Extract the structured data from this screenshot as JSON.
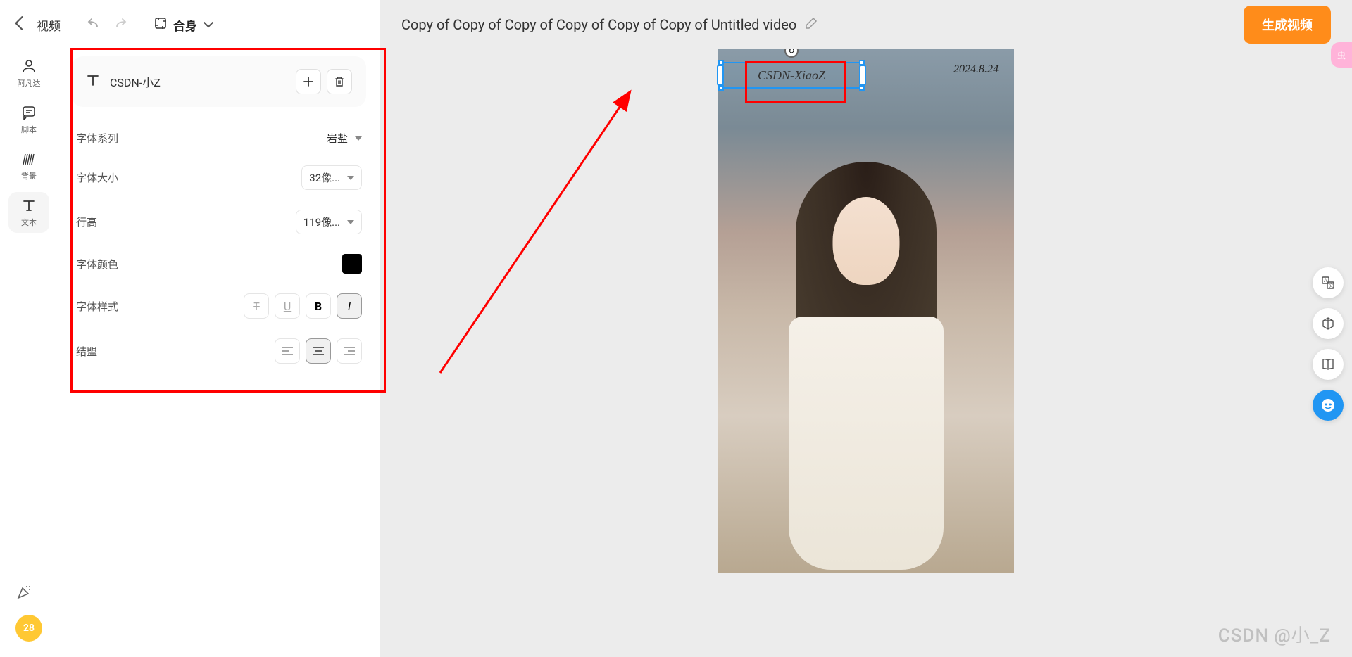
{
  "topBar": {
    "title": "视频",
    "fitLabel": "合身"
  },
  "leftToolbar": {
    "items": [
      {
        "id": "avatar",
        "label": "阿凡达"
      },
      {
        "id": "script",
        "label": "脚本"
      },
      {
        "id": "background",
        "label": "背景"
      },
      {
        "id": "text",
        "label": "文本"
      }
    ]
  },
  "textPanel": {
    "textValue": "CSDN-小Z",
    "props": {
      "fontFamilyLabel": "字体系列",
      "fontFamilyValue": "岩盐",
      "fontSizeLabel": "字体大小",
      "fontSizeValue": "32像...",
      "lineHeightLabel": "行高",
      "lineHeightValue": "119像...",
      "fontColorLabel": "字体颜色",
      "fontStyleLabel": "字体样式",
      "alignLabel": "结盟"
    }
  },
  "canvas": {
    "title": "Copy of Copy of Copy of Copy of Copy of Copy of Untitled video",
    "generateBtn": "生成视频",
    "overlayText": "CSDN-XiaoZ",
    "dateText": "2024.8.24"
  },
  "badge": "28",
  "watermark": "CSDN @小_Z"
}
